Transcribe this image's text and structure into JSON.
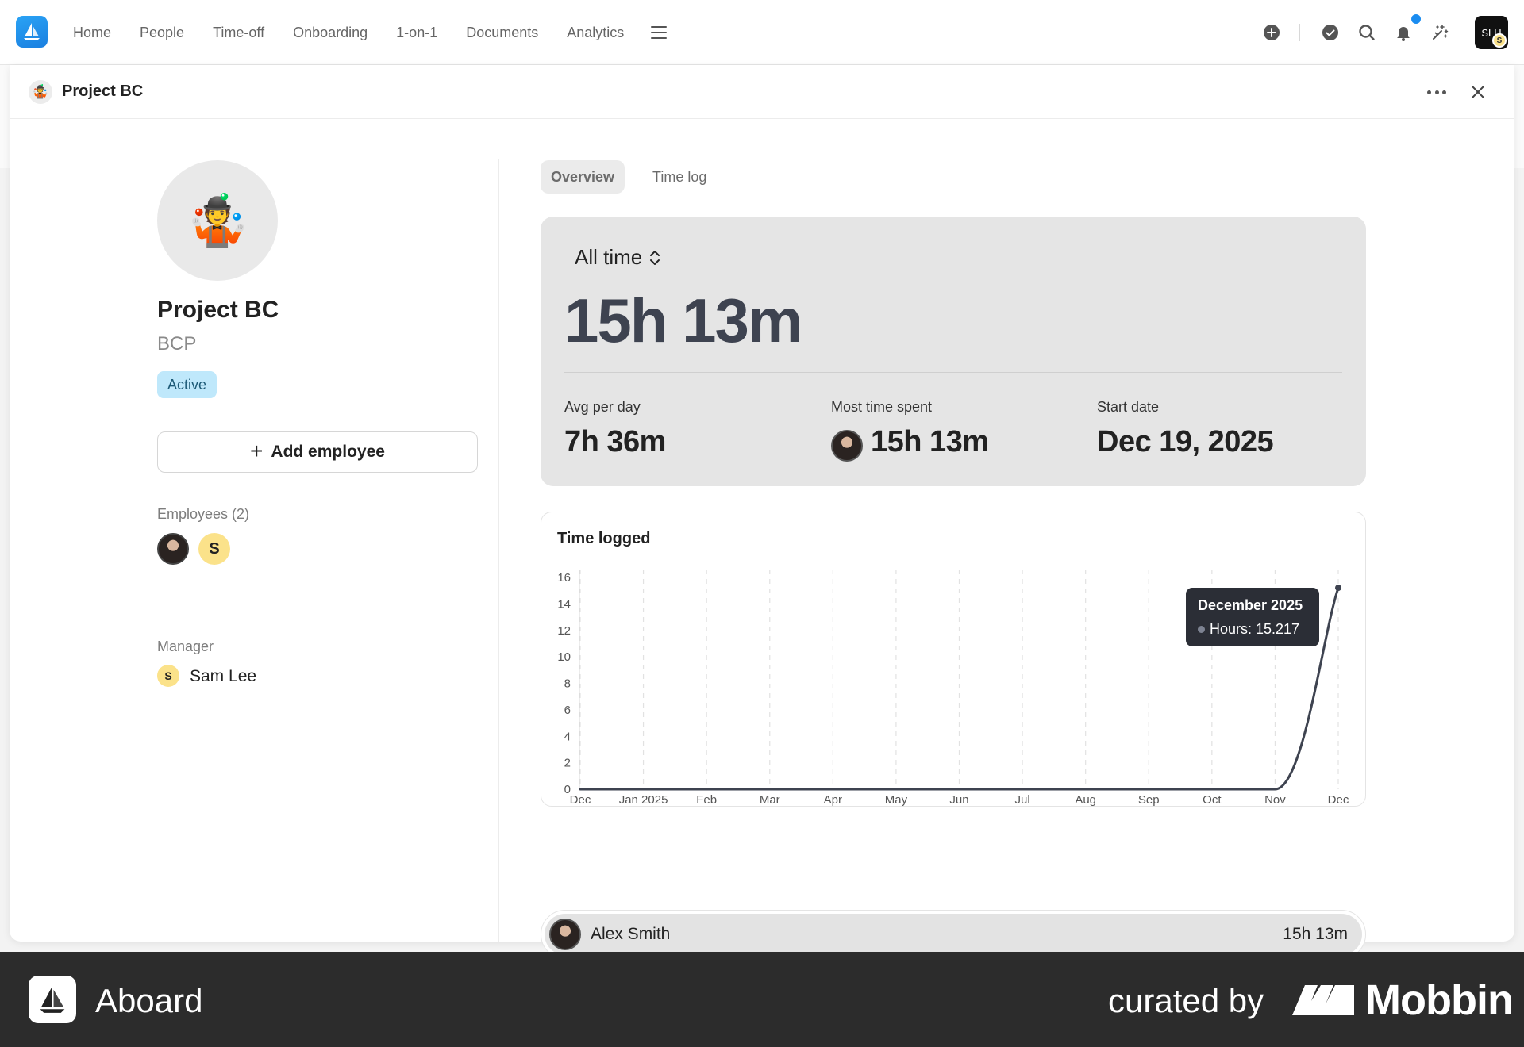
{
  "nav": {
    "items": [
      "Home",
      "People",
      "Time-off",
      "Onboarding",
      "1-on-1",
      "Documents",
      "Analytics"
    ],
    "avatar_text": "SLH",
    "avatar_badge": "S",
    "icons": [
      "plus-circle-icon",
      "check-circle-icon",
      "search-icon",
      "bell-icon",
      "sparkle-icon",
      "menu-icon"
    ],
    "accent": "#1a8cf0"
  },
  "panel": {
    "title": "Project BC",
    "emoji": "🤹"
  },
  "project": {
    "emoji": "🤹",
    "name": "Project BC",
    "code": "BCP",
    "status": "Active",
    "status_color": "#bfe8fb",
    "add_employee_label": "Add employee",
    "employees_label": "Employees (2)",
    "employee_initial": "S",
    "manager_label": "Manager",
    "manager_initial": "S",
    "manager_name": "Sam Lee"
  },
  "tabs": [
    {
      "label": "Overview",
      "active": true
    },
    {
      "label": "Time log",
      "active": false
    }
  ],
  "stats": {
    "range": "All time",
    "total": "15h 13m",
    "avg_label": "Avg per day",
    "avg_value": "7h 36m",
    "most_label": "Most time spent",
    "most_value": "15h 13m",
    "start_label": "Start date",
    "start_value": "Dec 19, 2025"
  },
  "chart_data": {
    "type": "line",
    "title": "Time logged",
    "categories": [
      "Dec",
      "Jan 2025",
      "Feb",
      "Mar",
      "Apr",
      "May",
      "Jun",
      "Jul",
      "Aug",
      "Sep",
      "Oct",
      "Nov",
      "Dec"
    ],
    "values": [
      0,
      0,
      0,
      0,
      0,
      0,
      0,
      0,
      0,
      0,
      0,
      0,
      15.217
    ],
    "yticks": [
      0,
      2,
      4,
      6,
      8,
      10,
      12,
      14,
      16
    ],
    "ylim": [
      0,
      16
    ],
    "grid": "vertical dashed",
    "tooltip": {
      "title": "December 2025",
      "line": "Hours: 15.217"
    },
    "line_color": "#3e4350"
  },
  "employee_rows": [
    {
      "name": "Alex Smith",
      "time": "15h 13m"
    }
  ],
  "footer": {
    "app": "Aboard",
    "curated": "curated by",
    "brand": "Mobbin"
  }
}
